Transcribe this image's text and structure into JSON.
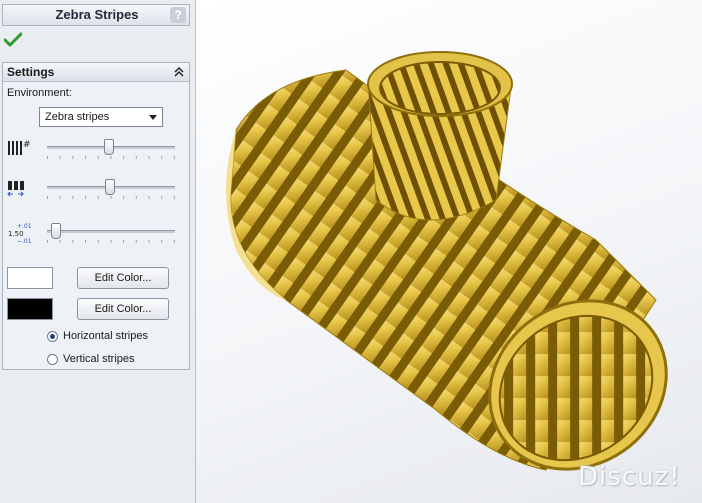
{
  "panel": {
    "title": "Zebra Stripes",
    "help_label": "?",
    "settings": {
      "title": "Settings",
      "environment_label": "Environment:",
      "environment_value": "Zebra stripes",
      "sliders": [
        {
          "name": "number-of-stripes",
          "icon": "stripe-count-icon",
          "value": 0.48
        },
        {
          "name": "stripe-width",
          "icon": "stripe-width-icon",
          "value": 0.49
        },
        {
          "name": "precision",
          "icon": "precision-icon",
          "icon_values": [
            "+.01",
            "1.50",
            "−.01"
          ],
          "value": 0.03
        }
      ],
      "color_1": {
        "swatch": "#ffffff",
        "button_label": "Edit Color..."
      },
      "color_2": {
        "swatch": "#000000",
        "button_label": "Edit Color..."
      },
      "orientation": [
        {
          "label": "Horizontal stripes",
          "checked": true
        },
        {
          "label": "Vertical stripes",
          "checked": false
        }
      ]
    }
  },
  "viewport": {
    "model": "pipe-tee-with-zebra-stripes",
    "watermark": "Discuz!"
  }
}
